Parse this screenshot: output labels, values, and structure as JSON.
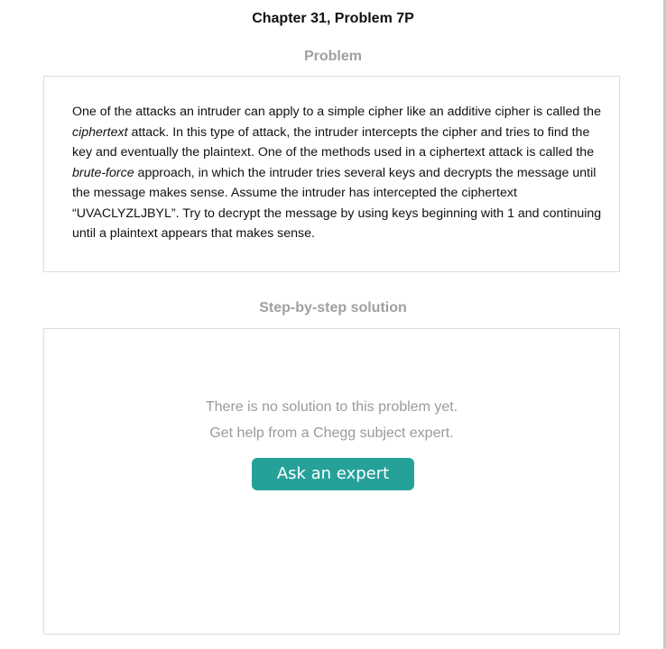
{
  "header": {
    "chapter_title": "Chapter 31, Problem 7P"
  },
  "problem": {
    "heading": "Problem",
    "segments": [
      {
        "text": "One of the attacks an intruder can apply to a simple cipher like an additive cipher is called the ",
        "italic": false
      },
      {
        "text": "ciphertext",
        "italic": true
      },
      {
        "text": " attack. In this type of attack, the intruder intercepts the cipher and tries to find the key and eventually the plaintext. One of the methods used in a ciphertext attack is called the ",
        "italic": false
      },
      {
        "text": "brute-force",
        "italic": true
      },
      {
        "text": " approach, in which the intruder tries several keys and decrypts the message until the message makes sense. Assume the intruder has intercepted the ciphertext “UVACLYZLJBYL”. Try to decrypt the message by using keys beginning with 1 and continuing until a plaintext appears that makes sense.",
        "italic": false
      }
    ]
  },
  "solution": {
    "heading": "Step-by-step solution",
    "empty_message_line1": "There is no solution to this problem yet.",
    "empty_message_line2": "Get help from a Chegg subject expert.",
    "ask_button_label": "Ask an expert"
  },
  "colors": {
    "accent": "#25a19a",
    "heading_gray": "#a0a0a0",
    "border": "#dcdcdc"
  }
}
